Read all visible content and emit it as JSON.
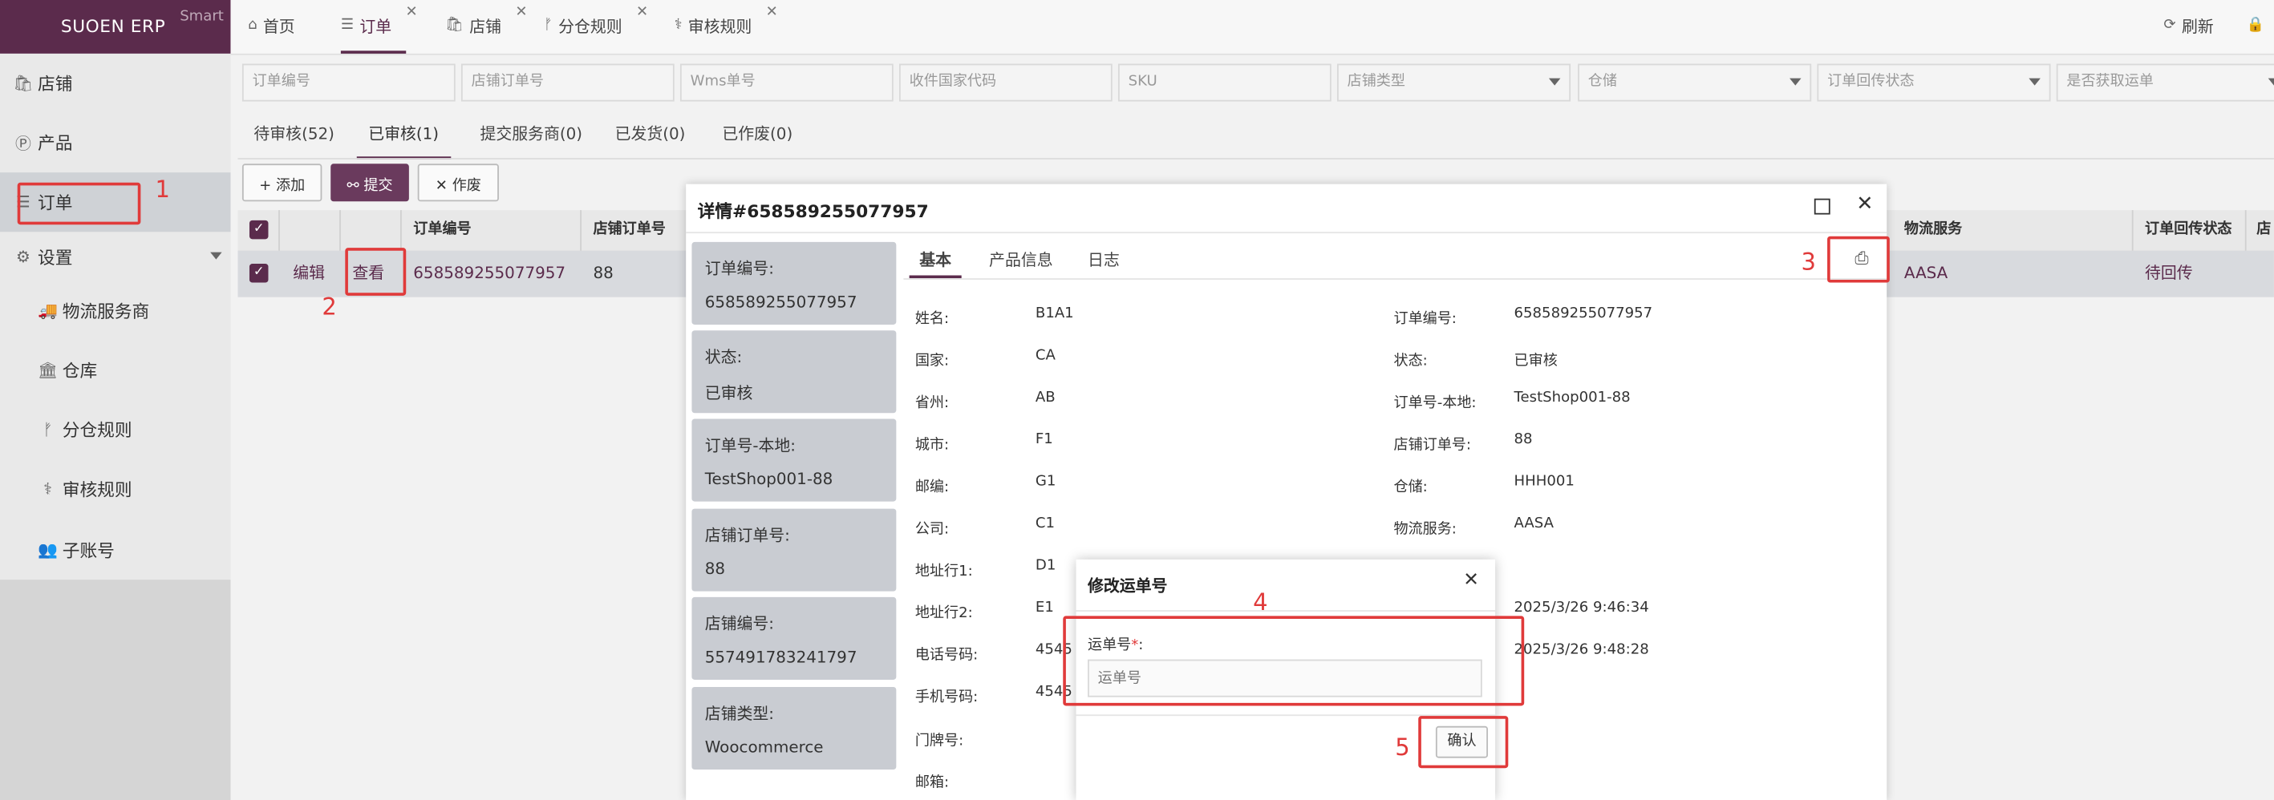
{
  "brand": {
    "name": "SUOEN ERP",
    "sub": "Smart"
  },
  "sidebar": {
    "items": [
      {
        "label": "店铺",
        "icon": "shop-icon",
        "glyph": "🛍"
      },
      {
        "label": "产品",
        "icon": "product-icon",
        "glyph": "Ⓟ"
      },
      {
        "label": "订单",
        "icon": "list-icon",
        "glyph": "☰"
      },
      {
        "label": "设置",
        "icon": "gear-icon",
        "glyph": "⚙"
      },
      {
        "label": "物流服务商",
        "icon": "truck-icon",
        "glyph": "🚚"
      },
      {
        "label": "仓库",
        "icon": "warehouse-icon",
        "glyph": "🏛"
      },
      {
        "label": "分仓规则",
        "icon": "branch-icon",
        "glyph": "ᚠ"
      },
      {
        "label": "审核规则",
        "icon": "stethoscope-icon",
        "glyph": "⚕"
      },
      {
        "label": "子账号",
        "icon": "users-icon",
        "glyph": "👥"
      }
    ]
  },
  "tabs": [
    {
      "label": "首页",
      "glyph": "⌂"
    },
    {
      "label": "订单",
      "glyph": "☰"
    },
    {
      "label": "店铺",
      "glyph": "🛍"
    },
    {
      "label": "分仓规则",
      "glyph": "ᚠ"
    },
    {
      "label": "审核规则",
      "glyph": "⚕"
    }
  ],
  "topright": {
    "refresh": "刷新",
    "refresh_glyph": "⟳",
    "user_glyph": "🔒"
  },
  "filters": [
    "订单编号",
    "店铺订单号",
    "Wms单号",
    "收件国家代码",
    "SKU",
    "店铺类型",
    "仓储",
    "订单回传状态",
    "是否获取运单"
  ],
  "status_tabs": [
    "待审核(52)",
    "已审核(1)",
    "提交服务商(0)",
    "已发货(0)",
    "已作废(0)"
  ],
  "actions": {
    "add": "+ 添加",
    "submit": "⚯ 提交",
    "void": "✕ 作废"
  },
  "table": {
    "headers": {
      "order_no": "订单编号",
      "shop_order_no": "店铺订单号",
      "logistics": "物流服务",
      "callback_status": "订单回传状态",
      "col_last": "店"
    },
    "row": {
      "edit": "编辑",
      "view": "查看",
      "order_no": "658589255077957",
      "shop_order_no": "88",
      "logistics": "AASA",
      "callback_status": "待回传"
    }
  },
  "detail": {
    "title": "详情#658589255077957",
    "tabs": [
      "基本",
      "产品信息",
      "日志"
    ],
    "cards": [
      {
        "label": "订单编号:",
        "value": "658589255077957"
      },
      {
        "label": "状态:",
        "value": "已审核"
      },
      {
        "label": "订单号-本地:",
        "value": "TestShop001-88"
      },
      {
        "label": "店铺订单号:",
        "value": "88"
      },
      {
        "label": "店铺编号:",
        "value": "557491783241797"
      },
      {
        "label": "店铺类型:",
        "value": "Woocommerce"
      }
    ],
    "left_fields": [
      {
        "label": "姓名:",
        "value": "B1A1"
      },
      {
        "label": "国家:",
        "value": "CA"
      },
      {
        "label": "省州:",
        "value": "AB"
      },
      {
        "label": "城市:",
        "value": "F1"
      },
      {
        "label": "邮编:",
        "value": "G1"
      },
      {
        "label": "公司:",
        "value": "C1"
      },
      {
        "label": "地址行1:",
        "value": "D1"
      },
      {
        "label": "地址行2:",
        "value": "E1"
      },
      {
        "label": "电话号码:",
        "value": "4545"
      },
      {
        "label": "手机号码:",
        "value": "4545"
      },
      {
        "label": "门牌号:",
        "value": ""
      },
      {
        "label": "邮箱:",
        "value": ""
      }
    ],
    "right_fields": [
      {
        "label": "订单编号:",
        "value": "658589255077957"
      },
      {
        "label": "状态:",
        "value": "已审核"
      },
      {
        "label": "订单号-本地:",
        "value": "TestShop001-88"
      },
      {
        "label": "店铺订单号:",
        "value": "88"
      },
      {
        "label": "仓储:",
        "value": "HHH001"
      },
      {
        "label": "物流服务:",
        "value": "AASA"
      }
    ],
    "times": [
      "2025/3/26 9:46:34",
      "2025/3/26 9:48:28"
    ]
  },
  "modal": {
    "title": "修改运单号",
    "field_label": "运单号",
    "required_mark": "*",
    "colon": ":",
    "placeholder": "运单号",
    "confirm": "确认"
  },
  "annotations": [
    "1",
    "2",
    "3",
    "4",
    "5"
  ],
  "colors": {
    "brand": "#5b2b4c",
    "annotation": "#e03a3a"
  }
}
